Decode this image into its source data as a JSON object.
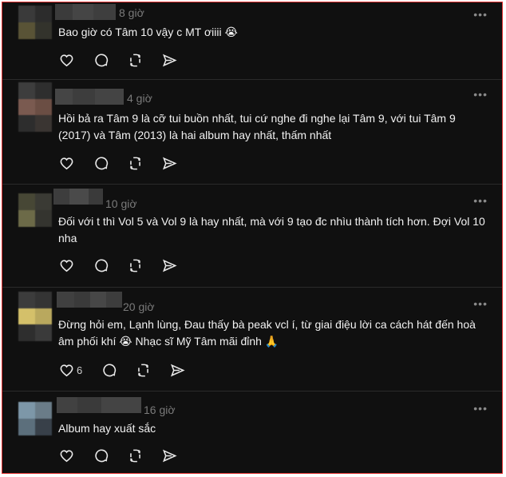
{
  "colors": {
    "background": "#101010",
    "text": "#f2f2f2",
    "muted": "#7a7a7a",
    "border": "#e03030"
  },
  "posts": [
    {
      "time": "8 giờ",
      "text": "Bao giờ có Tâm 10 vậy c MT ơiiii 😭",
      "likes": ""
    },
    {
      "time": "4 giờ",
      "text": "Hồi bả ra Tâm 9 là cỡ tui buồn nhất, tui cứ nghe đi nghe lại Tâm 9, với tui Tâm 9 (2017) và Tâm (2013) là hai album hay nhất, thấm nhất",
      "likes": ""
    },
    {
      "time": "10 giờ",
      "text": "Đối với t thì Vol 5 và Vol 9 là hay nhất, mà với 9 tạo đc nhìu thành tích hơn. Đợi Vol 10 nha",
      "likes": ""
    },
    {
      "time": "20 giờ",
      "text": "Đừng hỏi em, Lạnh lùng, Đau thấy bà peak vcl í, từ giai điệu lời ca cách hát đến hoà âm phối khí 😭 Nhạc sĩ Mỹ Tâm mãi đỉnh 🙏",
      "likes": "6"
    },
    {
      "time": "16 giờ",
      "text": "Album hay xuất sắc",
      "likes": ""
    }
  ],
  "icons": [
    "heart-icon",
    "comment-icon",
    "repost-icon",
    "share-icon",
    "more-icon"
  ],
  "more_label": "•••"
}
